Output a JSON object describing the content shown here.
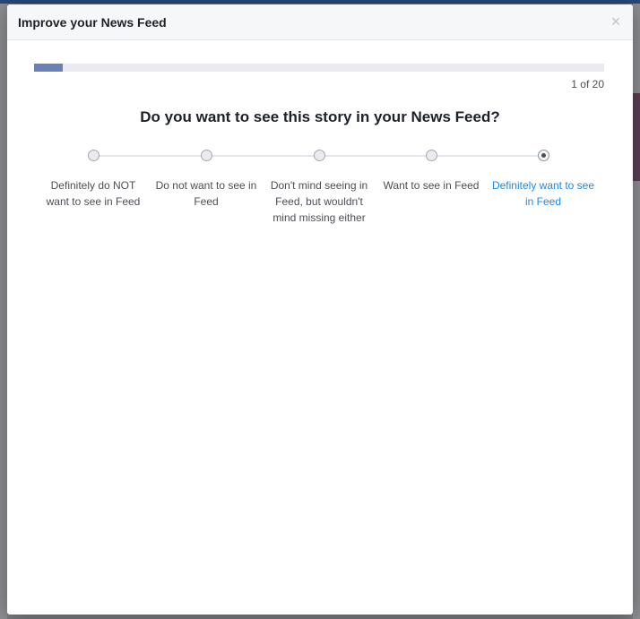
{
  "modal": {
    "title": "Improve your News Feed",
    "close_icon": "×"
  },
  "progress": {
    "text": "1 of 20",
    "fraction": 0.05
  },
  "question": "Do you want to see this story in your News Feed?",
  "options": [
    {
      "label": "Definitely do NOT want to see in Feed",
      "selected": false
    },
    {
      "label": "Do not want to see in Feed",
      "selected": false
    },
    {
      "label": "Don't mind seeing in Feed, but wouldn't mind missing either",
      "selected": false
    },
    {
      "label": "Want to see in Feed",
      "selected": false
    },
    {
      "label": "Definitely want to see in Feed",
      "selected": true
    }
  ],
  "colors": {
    "progress_fill": "#6a80b6",
    "selected_label": "#1e88e5",
    "header_bg": "#f6f7f9"
  }
}
